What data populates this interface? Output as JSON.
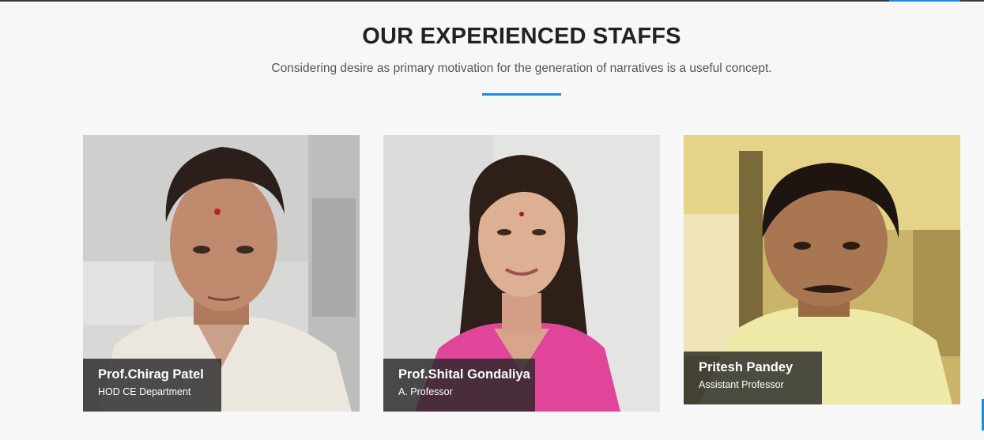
{
  "section": {
    "title": "OUR EXPERIENCED STAFFS",
    "subtitle": "Considering desire as primary motivation for the generation of narratives is a useful concept."
  },
  "staff": [
    {
      "name": "Prof.Chirag Patel",
      "role": "HOD CE Department"
    },
    {
      "name": "Prof.Shital Gondaliya",
      "role": "A. Professor"
    },
    {
      "name": "Pritesh Pandey",
      "role": "Assistant Professor"
    }
  ],
  "colors": {
    "accent": "#1e88e5",
    "caption_bg": "#282828",
    "background": "#f7f7f7"
  }
}
